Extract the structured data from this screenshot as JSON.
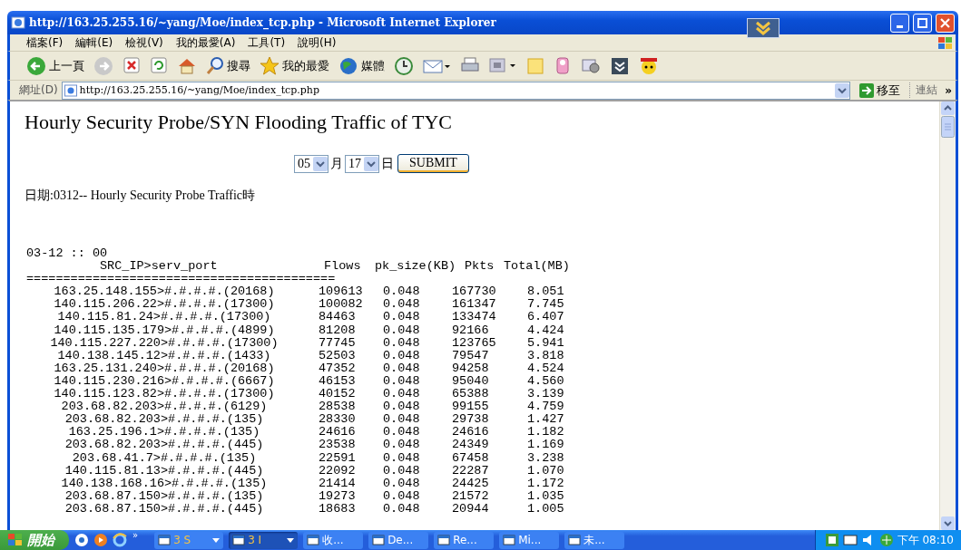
{
  "window": {
    "title": "http://163.25.255.16/~yang/Moe/index_tcp.php - Microsoft Internet Explorer"
  },
  "menu": [
    "檔案(F)",
    "編輯(E)",
    "檢視(V)",
    "我的最愛(A)",
    "工具(T)",
    "說明(H)"
  ],
  "toolbar": [
    {
      "kind": "back",
      "label": "上一頁"
    },
    {
      "kind": "forward"
    },
    {
      "kind": "stop"
    },
    {
      "kind": "refresh"
    },
    {
      "kind": "home"
    },
    {
      "kind": "search",
      "label": "搜尋"
    },
    {
      "kind": "favorites",
      "label": "我的最愛"
    },
    {
      "kind": "media",
      "label": "媒體"
    },
    {
      "kind": "history"
    },
    {
      "kind": "mail"
    },
    {
      "kind": "print"
    },
    {
      "kind": "edit"
    },
    {
      "kind": "note"
    },
    {
      "kind": "messenger"
    },
    {
      "kind": "tool"
    },
    {
      "kind": "research"
    },
    {
      "kind": "yahoo"
    }
  ],
  "address": {
    "label": "網址(D)",
    "value": "http://163.25.255.16/~yang/Moe/index_tcp.php",
    "go": "移至",
    "links": "連結",
    "more": "»"
  },
  "page": {
    "heading": "Hourly Security Probe/SYN Flooding Traffic of TYC",
    "month": {
      "value": "05",
      "unit": "月"
    },
    "day": {
      "value": "17",
      "unit": "日"
    },
    "submit": "SUBMIT",
    "date_line": "日期:0312-- Hourly Security Probe Traffic時",
    "hour": "03-12 :: 00",
    "columns": [
      "SRC_IP>serv_port",
      "Flows",
      "pk_size(KB)",
      "Pkts",
      "Total(MB)"
    ],
    "separator": "==========================================",
    "rows": [
      {
        "src": "163.25.148.155>#.#.#.#.(20168)",
        "flows": "109613",
        "pk_size": "0.048",
        "pkts": "167730",
        "total": "8.051"
      },
      {
        "src": "140.115.206.22>#.#.#.#.(17300)",
        "flows": "100082",
        "pk_size": "0.048",
        "pkts": "161347",
        "total": "7.745"
      },
      {
        "src": "140.115.81.24>#.#.#.#.(17300)",
        "flows": "84463",
        "pk_size": "0.048",
        "pkts": "133474",
        "total": "6.407"
      },
      {
        "src": "140.115.135.179>#.#.#.#.(4899)",
        "flows": "81208",
        "pk_size": "0.048",
        "pkts": "92166",
        "total": "4.424"
      },
      {
        "src": "140.115.227.220>#.#.#.#.(17300)",
        "flows": "77745",
        "pk_size": "0.048",
        "pkts": "123765",
        "total": "5.941"
      },
      {
        "src": "140.138.145.12>#.#.#.#.(1433)",
        "flows": "52503",
        "pk_size": "0.048",
        "pkts": "79547",
        "total": "3.818"
      },
      {
        "src": "163.25.131.240>#.#.#.#.(20168)",
        "flows": "47352",
        "pk_size": "0.048",
        "pkts": "94258",
        "total": "4.524"
      },
      {
        "src": "140.115.230.216>#.#.#.#.(6667)",
        "flows": "46153",
        "pk_size": "0.048",
        "pkts": "95040",
        "total": "4.560"
      },
      {
        "src": "140.115.123.82>#.#.#.#.(17300)",
        "flows": "40152",
        "pk_size": "0.048",
        "pkts": "65388",
        "total": "3.139"
      },
      {
        "src": "203.68.82.203>#.#.#.#.(6129)",
        "flows": "28538",
        "pk_size": "0.048",
        "pkts": "99155",
        "total": "4.759"
      },
      {
        "src": "203.68.82.203>#.#.#.#.(135)",
        "flows": "28330",
        "pk_size": "0.048",
        "pkts": "29738",
        "total": "1.427"
      },
      {
        "src": "163.25.196.1>#.#.#.#.(135)",
        "flows": "24616",
        "pk_size": "0.048",
        "pkts": "24616",
        "total": "1.182"
      },
      {
        "src": "203.68.82.203>#.#.#.#.(445)",
        "flows": "23538",
        "pk_size": "0.048",
        "pkts": "24349",
        "total": "1.169"
      },
      {
        "src": "203.68.41.7>#.#.#.#.(135)",
        "flows": "22591",
        "pk_size": "0.048",
        "pkts": "67458",
        "total": "3.238"
      },
      {
        "src": "140.115.81.13>#.#.#.#.(445)",
        "flows": "22092",
        "pk_size": "0.048",
        "pkts": "22287",
        "total": "1.070"
      },
      {
        "src": "140.138.168.16>#.#.#.#.(135)",
        "flows": "21414",
        "pk_size": "0.048",
        "pkts": "24425",
        "total": "1.172"
      },
      {
        "src": "203.68.87.150>#.#.#.#.(135)",
        "flows": "19273",
        "pk_size": "0.048",
        "pkts": "21572",
        "total": "1.035"
      },
      {
        "src": "203.68.87.150>#.#.#.#.(445)",
        "flows": "18683",
        "pk_size": "0.048",
        "pkts": "20944",
        "total": "1.005"
      }
    ]
  },
  "taskbar": {
    "start": "開始",
    "quick_launch_more": "»",
    "buttons": [
      {
        "label": "3 S",
        "selected": false,
        "group": true
      },
      {
        "label": "3 I",
        "selected": true,
        "group": true
      },
      {
        "label": "收...",
        "selected": false,
        "group": false
      },
      {
        "label": "De...",
        "selected": false,
        "group": false
      },
      {
        "label": "Re...",
        "selected": false,
        "group": false
      },
      {
        "label": "Mi...",
        "selected": false,
        "group": false
      },
      {
        "label": "未...",
        "selected": false,
        "group": false
      }
    ],
    "clock": "下午 08:10"
  }
}
